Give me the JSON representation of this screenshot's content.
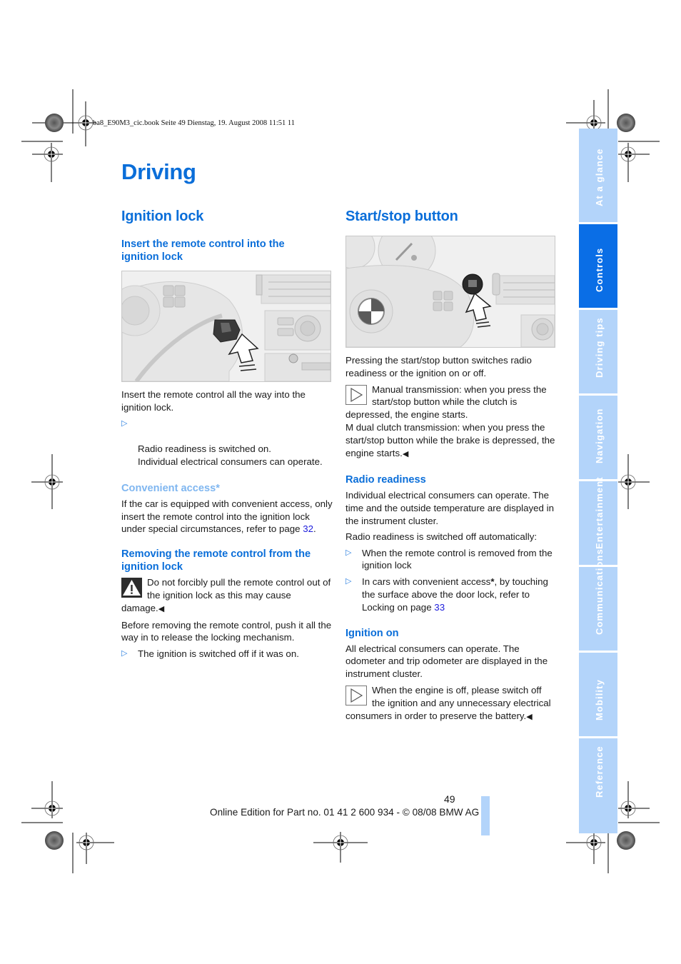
{
  "book_header": "ba8_E90M3_cic.book  Seite 49  Dienstag, 19. August 2008  11:51 11",
  "page_title": "Driving",
  "left_column": {
    "section_title": "Ignition lock",
    "insert": {
      "heading": "Insert the remote control into the ignition lock",
      "illustration_label": "Hand inserting remote control key into ignition lock on steering column",
      "paragraph": "Insert the remote control all the way into the ignition lock.",
      "bullets": [
        "Radio readiness is switched on.\nIndividual electrical consumers can operate."
      ]
    },
    "convenient_access": {
      "heading": "Convenient access*",
      "paragraph_before_link": "If the car is equipped with convenient access, only insert the remote control into the ignition lock under special circumstances, refer to page ",
      "page_link": "32",
      "paragraph_after_link": "."
    },
    "removing": {
      "heading": "Removing the remote control from the ignition lock",
      "warning_icon": "warning-triangle-icon",
      "warning_text": "Do not forcibly pull the remote control out of the ignition lock as this may cause damage.",
      "end_mark": "◀",
      "paragraph": "Before removing the remote control, push it all the way in to release the locking mechanism.",
      "bullets": [
        "The ignition is switched off if it was on."
      ]
    }
  },
  "right_column": {
    "section_title": "Start/stop button",
    "illustration_label": "Arrow pointing at start/stop button next to steering wheel",
    "intro": "Pressing the start/stop button switches radio readiness or the ignition on or off.",
    "note": {
      "icon": "note-arrow-icon",
      "text_manual": "Manual transmission: when you press the start/stop button while the clutch is depressed, the engine starts.",
      "text_dual": "M dual clutch transmission: when you press the start/stop button while the brake is depressed, the engine starts.",
      "end_mark": "◀"
    },
    "radio_readiness": {
      "heading": "Radio readiness",
      "paragraph": "Individual electrical consumers can operate. The time and the outside temperature are displayed in the instrument cluster.",
      "paragraph2": "Radio readiness is switched off automatically:",
      "bullets": [
        {
          "text": "When the remote control is removed from the ignition lock"
        },
        {
          "text_before": "In cars with convenient access",
          "asterisk": "*",
          "text_mid": ", by touching the surface above the door lock, refer to Locking on page ",
          "page_link": "33"
        }
      ]
    },
    "ignition_on": {
      "heading": "Ignition on",
      "paragraph": "All electrical consumers can operate. The odometer and trip odometer are displayed in the instrument cluster.",
      "note_icon": "note-arrow-icon",
      "note_text": "When the engine is off, please switch off the ignition and any unnecessary electrical consumers in order to preserve the battery.",
      "end_mark": "◀"
    }
  },
  "side_tabs": [
    {
      "label": "At a glance",
      "active": false
    },
    {
      "label": "Controls",
      "active": true
    },
    {
      "label": "Driving tips",
      "active": false
    },
    {
      "label": "Navigation",
      "active": false
    },
    {
      "label": "Entertainment",
      "active": false
    },
    {
      "label": "Communications",
      "active": false
    },
    {
      "label": "Mobility",
      "active": false
    },
    {
      "label": "Reference",
      "active": false
    }
  ],
  "footer": {
    "page_number": "49",
    "edition": "Online Edition for Part no. 01 41 2 600 934 - © 08/08 BMW AG"
  },
  "colors": {
    "heading_blue": "#0a6ed9",
    "subheading_light_blue": "#7fb6f0",
    "tab_inactive": "#b3d4fa",
    "tab_active": "#0a6ee6",
    "link": "#1c1cdc"
  }
}
